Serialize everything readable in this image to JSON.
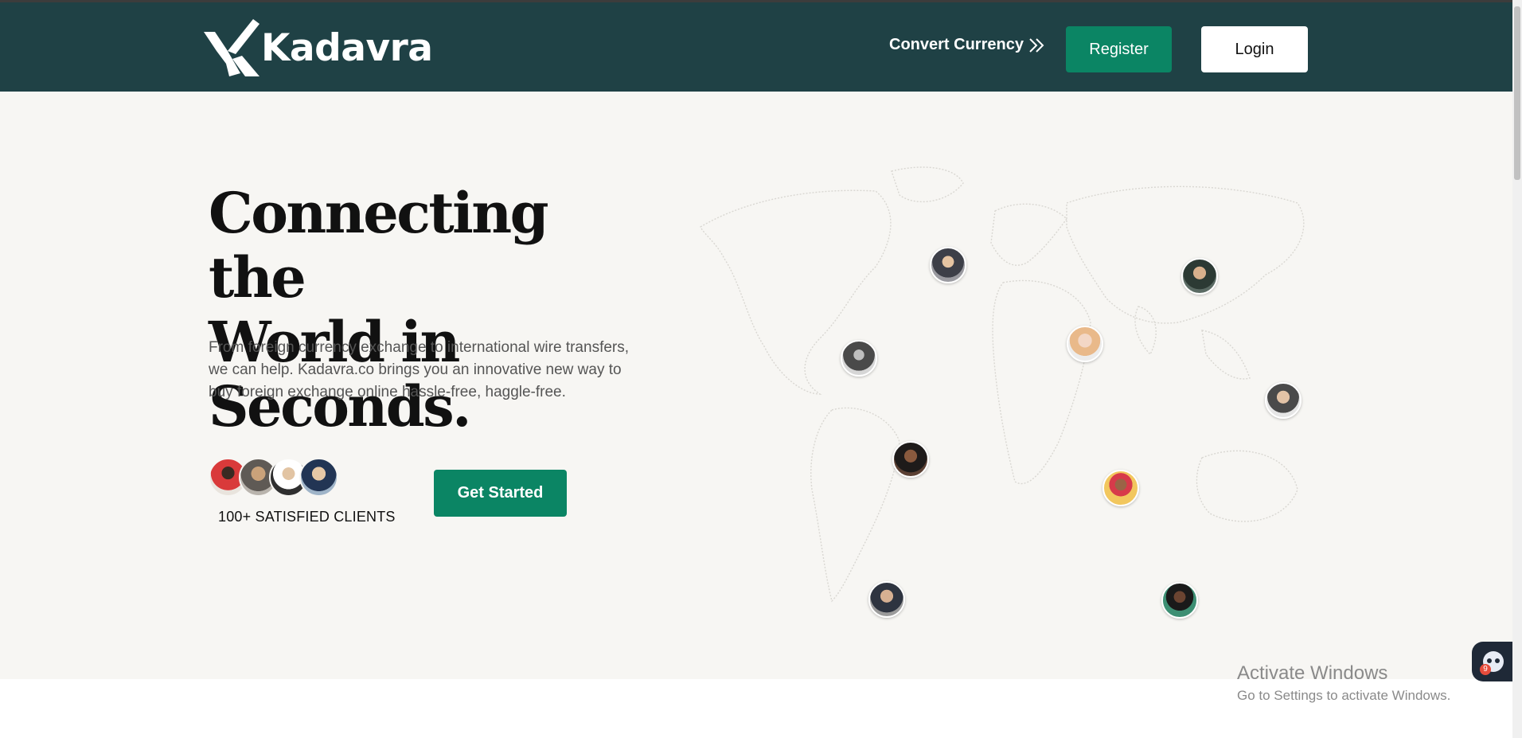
{
  "brand": {
    "name": "Kadavra",
    "accent": "#0b8564",
    "nav_bg": "#1f4145",
    "hero_bg": "#f7f6f3"
  },
  "nav": {
    "convert_label": "Convert Currency",
    "register_label": "Register",
    "login_label": "Login"
  },
  "hero": {
    "title_line1": "Connecting the",
    "title_line2": "World in Seconds.",
    "description": "From foreign currency exchange to international wire transfers, we can help. Kadavra.co brings you an innovative new way to buy foreign exchange online hassle-free, haggle-free.",
    "clients_label": "100+ SATISFIED CLIENTS",
    "cta_label": "Get Started"
  },
  "map": {
    "icon": "world-map-icon",
    "pin_icon": "person-avatar-icon"
  },
  "os": {
    "watermark_title": "Activate Windows",
    "watermark_sub": "Go to Settings to activate Windows.",
    "chat_badge": "9"
  }
}
